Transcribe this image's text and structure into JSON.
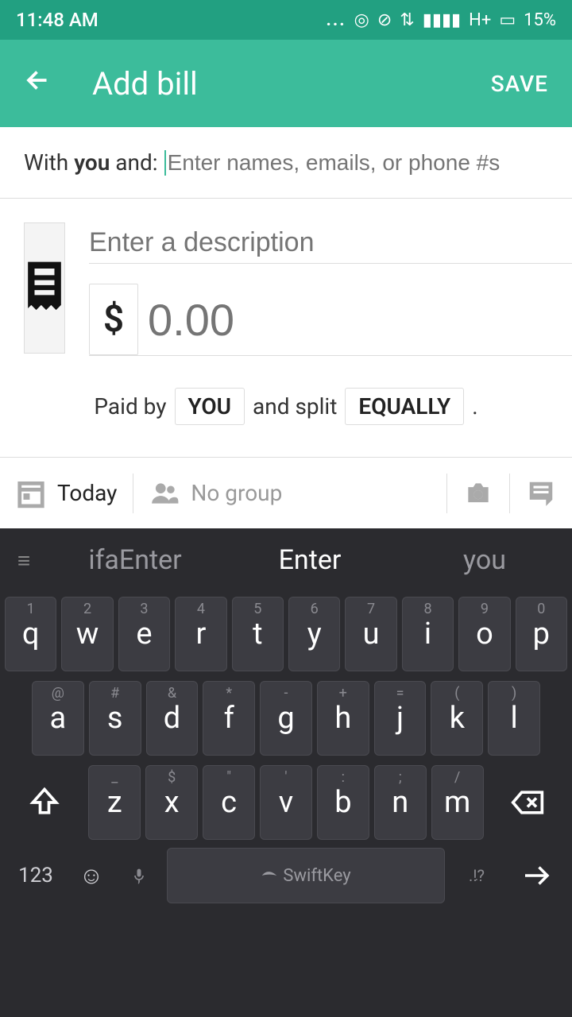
{
  "status": {
    "time": "11:48 AM",
    "network": "H+",
    "battery": "15%"
  },
  "appbar": {
    "title": "Add bill",
    "save": "SAVE"
  },
  "with": {
    "prefix": "With ",
    "you": "you",
    "and": " and: ",
    "placeholder": "Enter names, emails, or phone #s"
  },
  "bill": {
    "desc_placeholder": "Enter a description",
    "currency": "$",
    "amount_placeholder": "0.00"
  },
  "split": {
    "paid_by": "Paid by",
    "payer": "YOU",
    "and_split": "and split",
    "method": "EQUALLY",
    "dot": "."
  },
  "bottom": {
    "date": "Today",
    "group": "No group"
  },
  "kb": {
    "suggestions": [
      "ifaEnter",
      "Enter",
      "you"
    ],
    "row1": [
      {
        "m": "q",
        "a": "1"
      },
      {
        "m": "w",
        "a": "2"
      },
      {
        "m": "e",
        "a": "3"
      },
      {
        "m": "r",
        "a": "4"
      },
      {
        "m": "t",
        "a": "5"
      },
      {
        "m": "y",
        "a": "6"
      },
      {
        "m": "u",
        "a": "7"
      },
      {
        "m": "i",
        "a": "8"
      },
      {
        "m": "o",
        "a": "9"
      },
      {
        "m": "p",
        "a": "0"
      }
    ],
    "row2": [
      {
        "m": "a",
        "a": "@"
      },
      {
        "m": "s",
        "a": "#"
      },
      {
        "m": "d",
        "a": "&"
      },
      {
        "m": "f",
        "a": "*"
      },
      {
        "m": "g",
        "a": "-"
      },
      {
        "m": "h",
        "a": "+"
      },
      {
        "m": "j",
        "a": "="
      },
      {
        "m": "k",
        "a": "("
      },
      {
        "m": "l",
        "a": ")"
      }
    ],
    "row3": [
      {
        "m": "z",
        "a": "_"
      },
      {
        "m": "x",
        "a": "$"
      },
      {
        "m": "c",
        "a": "\""
      },
      {
        "m": "v",
        "a": "'"
      },
      {
        "m": "b",
        "a": ":"
      },
      {
        "m": "n",
        "a": ";"
      },
      {
        "m": "m",
        "a": "/"
      }
    ],
    "numkey": "123",
    "space": "SwiftKey",
    "punct": ".!?",
    "comma": ",",
    "period": "."
  }
}
